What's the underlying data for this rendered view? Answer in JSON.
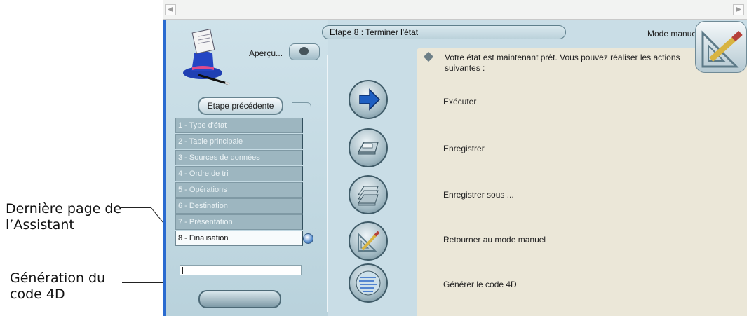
{
  "callouts": {
    "last_page": "Dernière page de\nl’Assistant",
    "code_generation": "Génération du\ncode 4D"
  },
  "toolbar": {
    "preview_label": "Aperçu...",
    "step_title": "Etape 8 : Terminer l'état",
    "mode_label": "Mode manuel"
  },
  "navigation": {
    "previous_label": "Etape précédente"
  },
  "steps": [
    {
      "label": "1 - Type d'état"
    },
    {
      "label": "2 - Table principale"
    },
    {
      "label": "3 - Sources de données"
    },
    {
      "label": "4 - Ordre de tri"
    },
    {
      "label": "5 - Opérations"
    },
    {
      "label": "6 - Destination"
    },
    {
      "label": "7 - Présentation"
    },
    {
      "label": "8 - Finalisation"
    }
  ],
  "panel": {
    "intro": "Votre état est maintenant prêt. Vous pouvez réaliser les actions suivantes :"
  },
  "actions": [
    {
      "label": "Exécuter",
      "icon": "run-arrow-icon"
    },
    {
      "label": "Enregistrer",
      "icon": "save-disk-icon"
    },
    {
      "label": "Enregistrer sous ...",
      "icon": "save-as-disks-icon"
    },
    {
      "label": "Retourner au mode manuel",
      "icon": "manual-mode-tools-icon"
    },
    {
      "label": "Générer le code 4D",
      "icon": "generate-code-icon"
    }
  ],
  "colors": {
    "window_bg": "#c9dde6",
    "panel_bg": "#ebe7d8",
    "accent_blue": "#1f5fc2"
  }
}
